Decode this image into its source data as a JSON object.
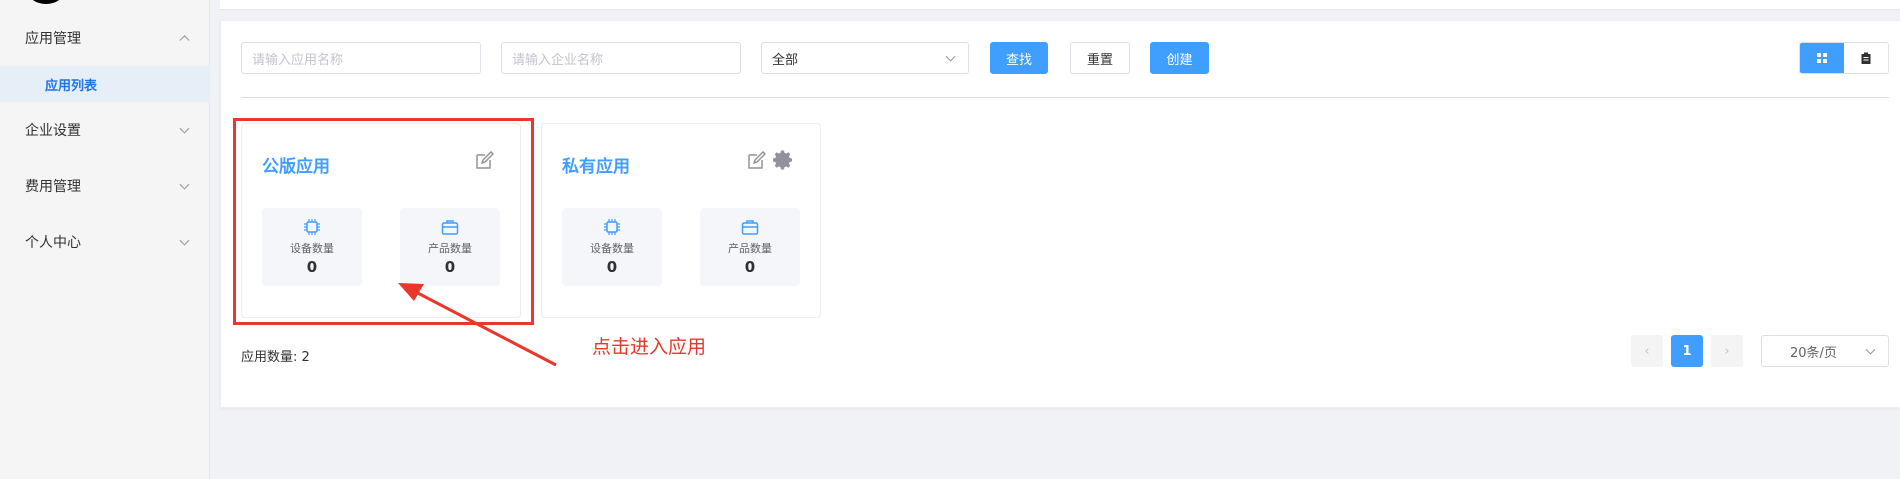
{
  "sidebar": {
    "menus": [
      {
        "label": "应用管理",
        "expanded": true
      },
      {
        "label": "企业设置",
        "expanded": false
      },
      {
        "label": "费用管理",
        "expanded": false
      },
      {
        "label": "个人中心",
        "expanded": false
      }
    ],
    "submenu_active": "应用列表"
  },
  "toolbar": {
    "app_name_placeholder": "请输入应用名称",
    "company_name_placeholder": "请输入企业名称",
    "select_value": "全部",
    "search_label": "查找",
    "reset_label": "重置",
    "create_label": "创建"
  },
  "cards": [
    {
      "title": "公版应用",
      "has_settings": false,
      "stats": [
        {
          "label": "设备数量",
          "value": "0"
        },
        {
          "label": "产品数量",
          "value": "0"
        }
      ]
    },
    {
      "title": "私有应用",
      "has_settings": true,
      "stats": [
        {
          "label": "设备数量",
          "value": "0"
        },
        {
          "label": "产品数量",
          "value": "0"
        }
      ]
    }
  ],
  "footer": {
    "count_text": "应用数量: 2",
    "current_page": "1",
    "page_size": "20条/页"
  },
  "annotation": {
    "text": "点击进入应用",
    "color": "#e8382b"
  },
  "colors": {
    "primary": "#409eff",
    "annotation": "#e8382b"
  }
}
